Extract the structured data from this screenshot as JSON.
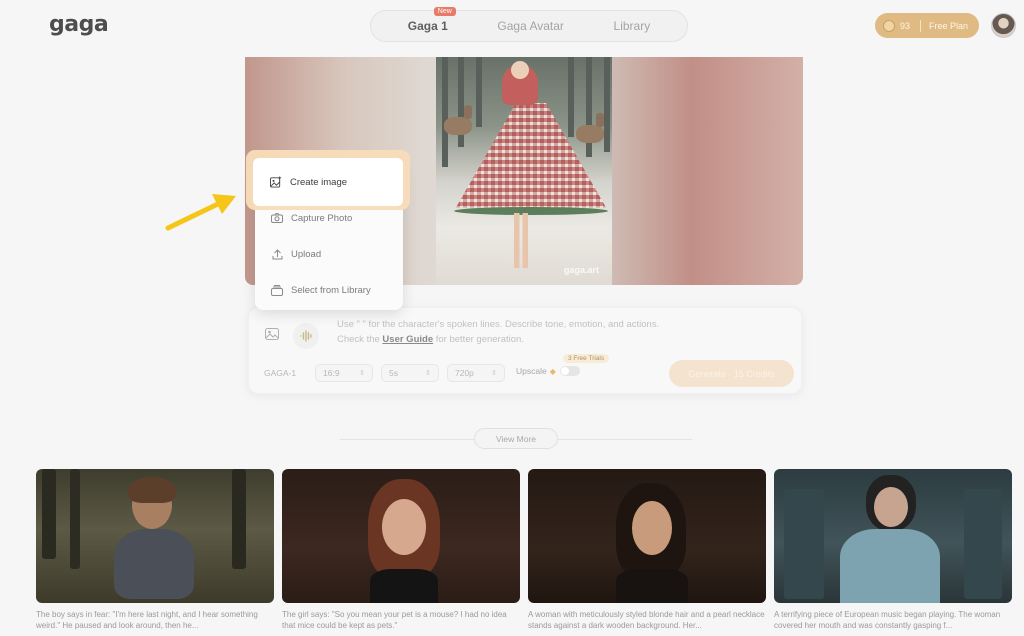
{
  "header": {
    "logo": "gaga",
    "tabs": [
      {
        "label": "Gaga 1",
        "badge": "New"
      },
      {
        "label": "Gaga Avatar"
      },
      {
        "label": "Library"
      }
    ],
    "credits": "93",
    "plan": "Free Plan"
  },
  "hero": {
    "watermark": "gaga.art"
  },
  "menu": {
    "items": [
      {
        "label": "Create image",
        "icon": "image-plus-icon"
      },
      {
        "label": "Capture Photo",
        "icon": "camera-icon"
      },
      {
        "label": "Upload",
        "icon": "upload-icon"
      },
      {
        "label": "Select from Library",
        "icon": "library-icon"
      }
    ]
  },
  "prompt": {
    "line1": "Use \" \" for the character's spoken lines. Describe tone, emotion, and actions.",
    "line2_prefix": "Check the ",
    "line2_link": "User Guide",
    "line2_suffix": " for better generation."
  },
  "options": {
    "model": "GAGA-1",
    "aspect": "16:9",
    "duration": "5s",
    "resolution": "720p",
    "upscale_label": "Upscale",
    "free_trials": "3 Free Trials",
    "generate_label": "Generate · 15 Credits"
  },
  "view_more": "View More",
  "gallery": [
    {
      "caption": "The boy says in fear: \"I'm here last night, and I hear something weird.\" He paused and look around, then he..."
    },
    {
      "caption": "The girl says: \"So you mean your pet is a mouse? I had no idea that mice could be kept as pets.\""
    },
    {
      "caption": "A woman with meticulously styled blonde hair and a pearl necklace stands against a dark wooden background. Her..."
    },
    {
      "caption": "A terrifying piece of European music began playing. The woman covered her mouth and was constantly gasping f..."
    }
  ],
  "colors": {
    "accent_gold": "#d7a760",
    "highlight": "#f7ddb9",
    "arrow": "#f5c518",
    "badge_red": "#e2553f"
  }
}
